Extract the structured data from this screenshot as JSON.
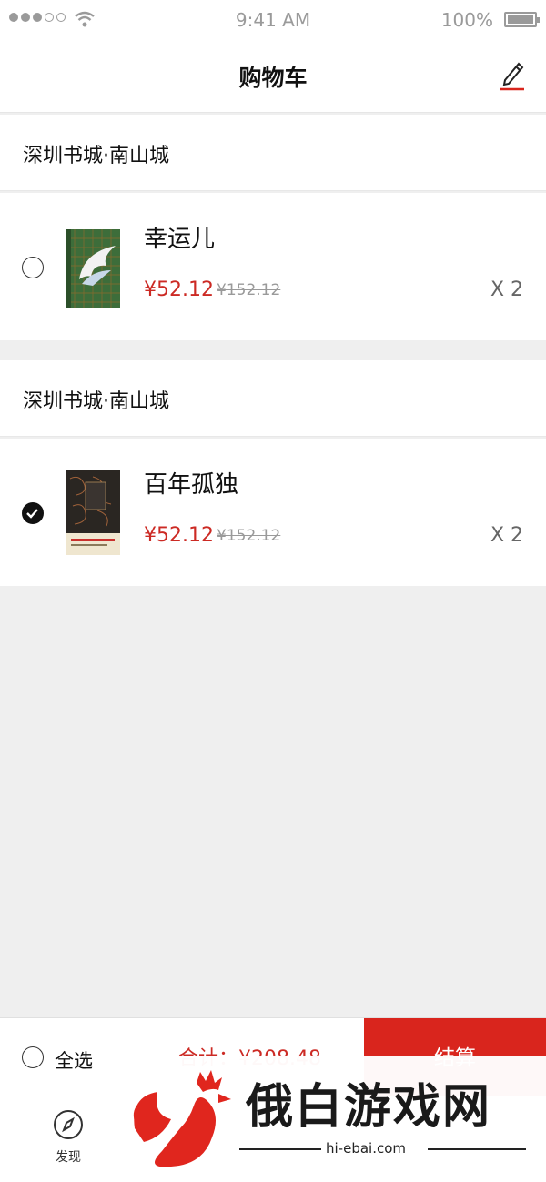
{
  "status_bar": {
    "time": "9:41 AM",
    "battery": "100%"
  },
  "navbar": {
    "title": "购物车",
    "edit_icon": "pencil-icon"
  },
  "shops": [
    {
      "name": "深圳书城·南山城",
      "items": [
        {
          "title": "幸运儿",
          "price": "¥52.12",
          "original_price": "¥152.12",
          "quantity": "X 2",
          "selected": false
        }
      ]
    },
    {
      "name": "深圳书城·南山城",
      "items": [
        {
          "title": "百年孤独",
          "price": "¥52.12",
          "original_price": "¥152.12",
          "quantity": "X 2",
          "selected": true
        }
      ]
    }
  ],
  "checkout": {
    "select_all_label": "全选",
    "total_label": "合计：¥208.48",
    "button_label": "结算"
  },
  "tabbar": {
    "tabs": [
      {
        "label": "发现",
        "icon": "compass-icon"
      }
    ]
  },
  "watermark": {
    "text": "俄白游戏网",
    "url": "hi-ebai.com"
  },
  "colors": {
    "accent": "#d9251d",
    "price": "#cc2a24",
    "background": "#efefef"
  }
}
